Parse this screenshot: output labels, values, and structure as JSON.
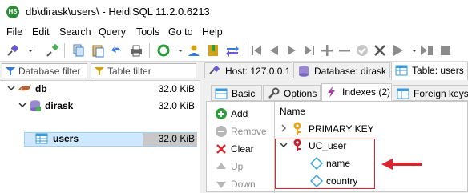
{
  "window": {
    "title": "db\\dirask\\users\\ - HeidiSQL 11.2.0.6213",
    "app_icon_text": "HS"
  },
  "menu": [
    "File",
    "Edit",
    "Search",
    "Query",
    "Tools",
    "Go to",
    "Help"
  ],
  "toolbar_icons": [
    "connect-icon",
    "disconnect-icon",
    "copy-icon",
    "paste-icon",
    "undo-icon",
    "print-icon",
    "refresh-icon",
    "dropdown-icon",
    "user-manager-icon",
    "bookmark-icon",
    "transfer-icon",
    "first-icon",
    "prev-icon",
    "next-icon",
    "last-icon",
    "add-icon",
    "remove-icon",
    "apply-icon",
    "cancel-icon",
    "run-icon",
    "run-dropdown-icon",
    "run-line-icon",
    "stop-icon"
  ],
  "filters": {
    "database": "Database filter",
    "table": "Table filter"
  },
  "tree": [
    {
      "label": "db",
      "size": "32.0 KiB",
      "level": 0
    },
    {
      "label": "dirask",
      "size": "32.0 KiB",
      "level": 1
    },
    {
      "label": "users",
      "size": "32.0 KiB",
      "level": 2,
      "selected": true
    }
  ],
  "top_tabs": [
    {
      "label": "Host: 127.0.0.1"
    },
    {
      "label": "Database: dirask"
    },
    {
      "label": "Table: users",
      "active": true
    }
  ],
  "sub_tabs": [
    {
      "label": "Basic"
    },
    {
      "label": "Options"
    },
    {
      "label": "Indexes (2)",
      "active": true
    },
    {
      "label": "Foreign keys"
    }
  ],
  "side_buttons": [
    {
      "label": "Add",
      "enabled": true
    },
    {
      "label": "Remove",
      "enabled": false
    },
    {
      "label": "Clear",
      "enabled": true
    },
    {
      "label": "Up",
      "enabled": false
    },
    {
      "label": "Down",
      "enabled": false
    }
  ],
  "index_grid": {
    "header": "Name",
    "rows": [
      {
        "label": "PRIMARY KEY",
        "type": "primary",
        "expanded": false
      },
      {
        "label": "UC_user",
        "type": "unique",
        "expanded": true
      },
      {
        "label": "name",
        "type": "column"
      },
      {
        "label": "country",
        "type": "column"
      }
    ]
  },
  "colors": {
    "highlight": "#d9262e",
    "selection": "#cde8ff",
    "key_gold": "#e8a317"
  }
}
